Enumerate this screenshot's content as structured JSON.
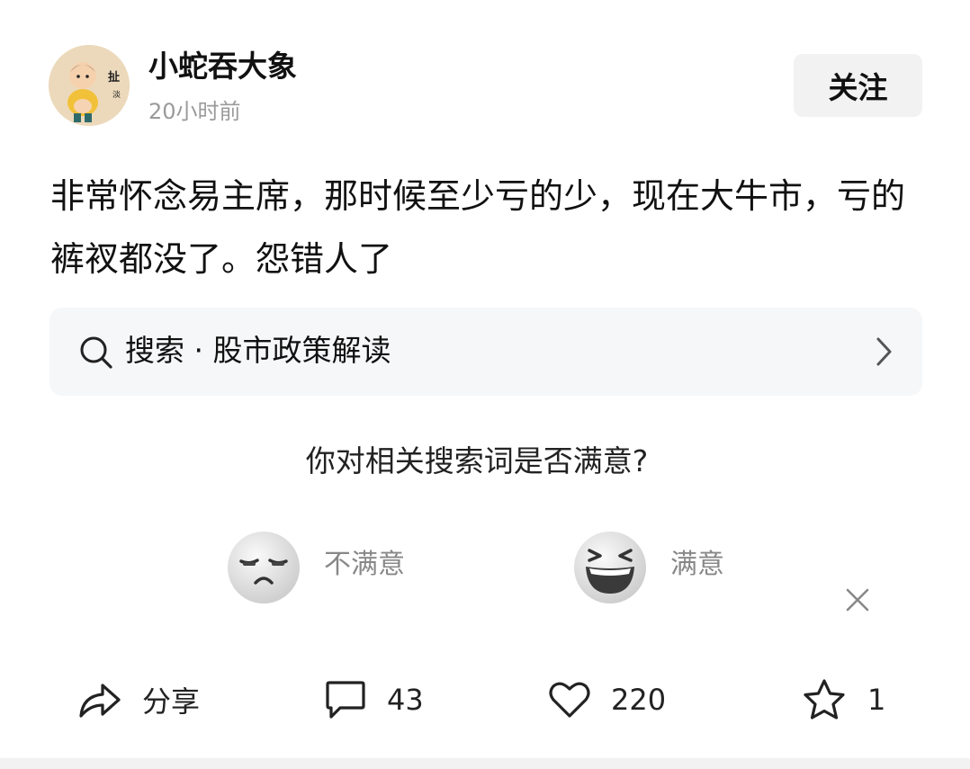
{
  "post": {
    "username": "小蛇吞大象",
    "time": "20小时前",
    "follow_label": "关注",
    "content": "非常怀念易主席，那时候至少亏的少，现在大牛市，亏的裤衩都没了。怨错人了"
  },
  "search": {
    "text": "搜索 · 股市政策解读",
    "icon": "search-icon"
  },
  "feedback": {
    "question": "你对相关搜索词是否满意?",
    "options": [
      {
        "label": "不满意",
        "icon": "frown-face-icon"
      },
      {
        "label": "满意",
        "icon": "laughing-face-icon"
      }
    ]
  },
  "actions": {
    "share_label": "分享",
    "comments": "43",
    "likes": "220",
    "favorites": "1"
  }
}
